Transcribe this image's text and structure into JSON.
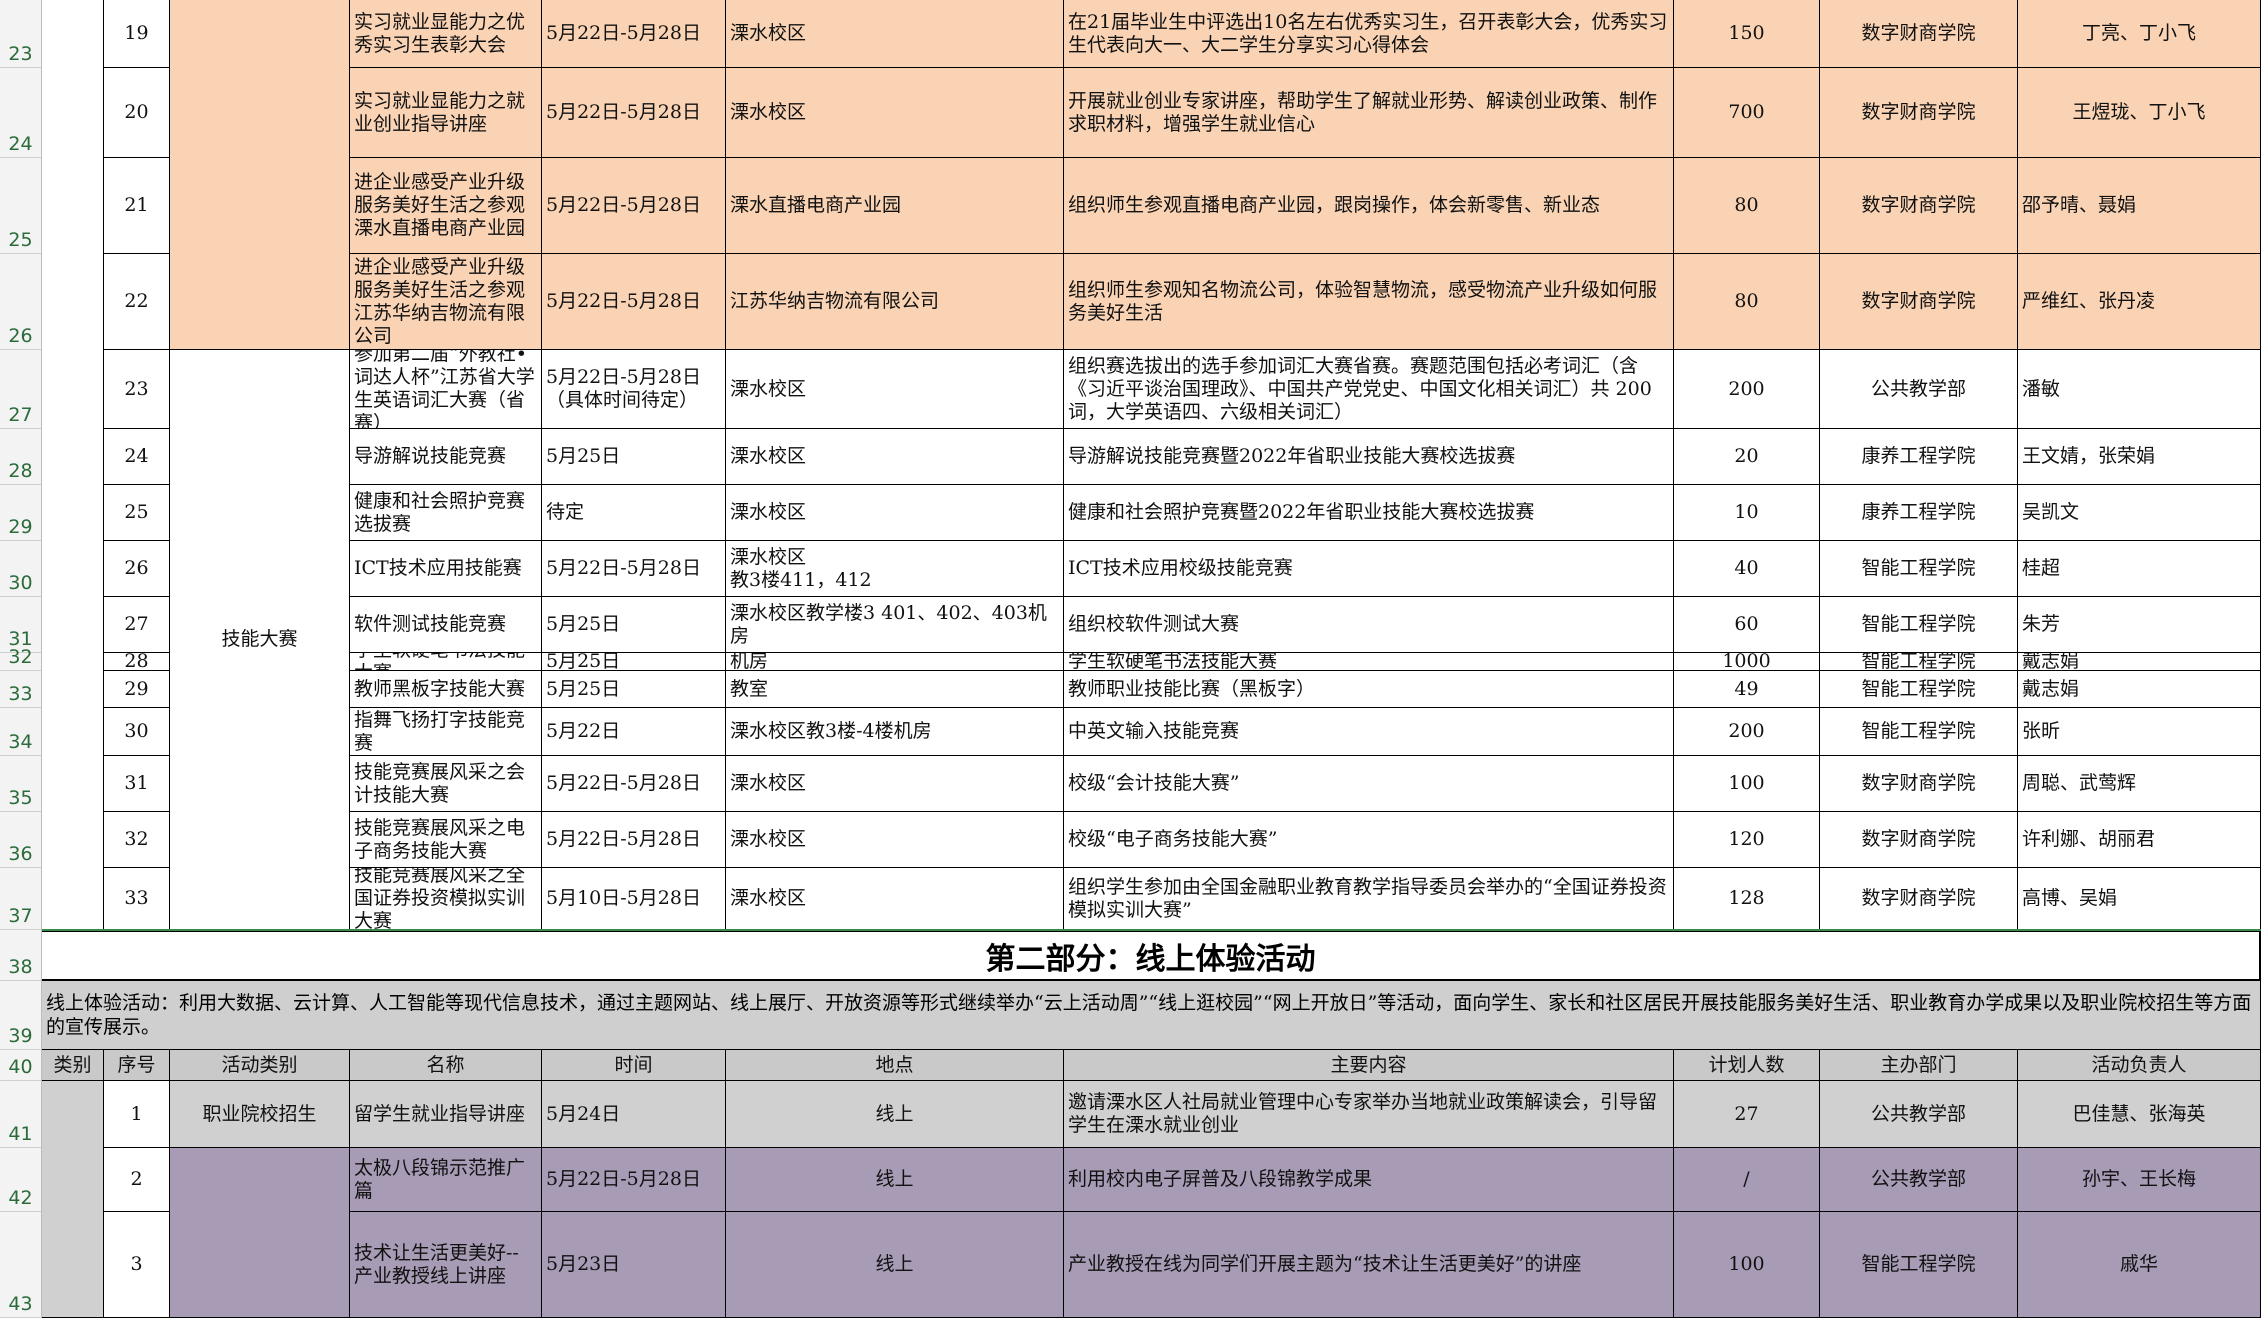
{
  "row_numbers": [
    "23",
    "24",
    "25",
    "26",
    "27",
    "28",
    "29",
    "30",
    "31",
    "32",
    "33",
    "34",
    "35",
    "36",
    "37",
    "38",
    "39",
    "40",
    "41",
    "42",
    "43"
  ],
  "part1": {
    "rows": [
      {
        "seq": "19",
        "name": "实习就业显能力之优秀实习生表彰大会",
        "time": "5月22日-5月28日",
        "place": "溧水校区",
        "content": "在21届毕业生中评选出10名左右优秀实习生，召开表彰大会，优秀实习生代表向大一、大二学生分享实习心得体会",
        "count": "150",
        "dept": "数字财商学院",
        "owner": "丁亮、丁小飞"
      },
      {
        "seq": "20",
        "name": "实习就业显能力之就业创业指导讲座",
        "time": "5月22日-5月28日",
        "place": "溧水校区",
        "content": "开展就业创业专家讲座，帮助学生了解就业形势、解读创业政策、制作求职材料，增强学生就业信心",
        "count": "700",
        "dept": "数字财商学院",
        "owner": "王煜珑、丁小飞"
      },
      {
        "seq": "21",
        "name": "进企业感受产业升级服务美好生活之参观溧水直播电商产业园",
        "time": "5月22日-5月28日",
        "place": "溧水直播电商产业园",
        "content": "组织师生参观直播电商产业园，跟岗操作，体会新零售、新业态",
        "count": "80",
        "dept": "数字财商学院",
        "owner": "邵予晴、聂娟"
      },
      {
        "seq": "22",
        "name": "进企业感受产业升级服务美好生活之参观江苏华纳吉物流有限公司",
        "time": "5月22日-5月28日",
        "place": "江苏华纳吉物流有限公司",
        "content": "组织师生参观知名物流公司，体验智慧物流，感受物流产业升级如何服务美好生活",
        "count": "80",
        "dept": "数字财商学院",
        "owner": "严维红、张丹凌"
      },
      {
        "seq": "23",
        "name": "参加第二届“外教社•词达人杯”江苏省大学生英语词汇大赛（省赛）",
        "time": "5月22日-5月28日（具体时间待定）",
        "place": "溧水校区",
        "content": "组织赛选拔出的选手参加词汇大赛省赛。赛题范围包括必考词汇（含《习近平谈治国理政》、中国共产党党史、中国文化相关词汇）共 200 词，大学英语四、六级相关词汇）",
        "count": "200",
        "dept": "公共教学部",
        "owner": "潘敏"
      },
      {
        "seq": "24",
        "name": "导游解说技能竞赛",
        "time": "5月25日",
        "place": "溧水校区",
        "content": "导游解说技能竞赛暨2022年省职业技能大赛校选拔赛",
        "count": "20",
        "dept": "康养工程学院",
        "owner": "王文婧，张荣娟"
      },
      {
        "seq": "25",
        "name": "健康和社会照护竞赛选拔赛",
        "time": "待定",
        "place": "溧水校区",
        "content": "健康和社会照护竞赛暨2022年省职业技能大赛校选拔赛",
        "count": "10",
        "dept": "康养工程学院",
        "owner": "吴凯文"
      },
      {
        "seq": "26",
        "name": "ICT技术应用技能赛",
        "time": "5月22日-5月28日",
        "place": "溧水校区\n教3楼411，412",
        "content": "ICT技术应用校级技能竞赛",
        "count": "40",
        "dept": "智能工程学院",
        "owner": "桂超"
      },
      {
        "seq": "27",
        "name": "软件测试技能竞赛",
        "time": "5月25日",
        "place": "溧水校区教学楼3 401、402、403机房",
        "content": "组织校软件测试大赛",
        "count": "60",
        "dept": "智能工程学院",
        "owner": "朱芳"
      },
      {
        "seq": "28",
        "name": "学生软硬笔书法技能大赛",
        "time": "5月25日",
        "place": "机房",
        "content": "学生软硬笔书法技能大赛",
        "count": "1000",
        "dept": "智能工程学院",
        "owner": "戴志娟"
      },
      {
        "seq": "29",
        "name": "教师黑板字技能大赛",
        "time": "5月25日",
        "place": "教室",
        "content": "教师职业技能比赛（黑板字）",
        "count": "49",
        "dept": "智能工程学院",
        "owner": "戴志娟"
      },
      {
        "seq": "30",
        "name": "指舞飞扬打字技能竞赛",
        "time": "5月22日",
        "place": "溧水校区教3楼-4楼机房",
        "content": "中英文输入技能竞赛",
        "count": "200",
        "dept": "智能工程学院",
        "owner": "张昕"
      },
      {
        "seq": "31",
        "name": "技能竞赛展风采之会计技能大赛",
        "time": "5月22日-5月28日",
        "place": "溧水校区",
        "content": "校级“会计技能大赛”",
        "count": "100",
        "dept": "数字财商学院",
        "owner": "周聪、武莺辉"
      },
      {
        "seq": "32",
        "name": "技能竞赛展风采之电子商务技能大赛",
        "time": "5月22日-5月28日",
        "place": "溧水校区",
        "content": "校级“电子商务技能大赛”",
        "count": "120",
        "dept": "数字财商学院",
        "owner": "许利娜、胡丽君"
      },
      {
        "seq": "33",
        "name": "技能竞赛展风采之全国证券投资模拟实训大赛",
        "time": "5月10日-5月28日",
        "place": "溧水校区",
        "content": "组织学生参加由全国金融职业教育教学指导委员会举办的“全国证券投资模拟实训大赛”",
        "count": "128",
        "dept": "数字财商学院",
        "owner": "高博、吴娟"
      }
    ],
    "skill_category": "技能大赛"
  },
  "part2": {
    "title": "第二部分：线上体验活动",
    "description": "线上体验活动：利用大数据、云计算、人工智能等现代信息技术，通过主题网站、线上展厅、开放资源等形式继续举办“云上活动周”“线上逛校园”“网上开放日”等活动，面向学生、家长和社区居民开展技能服务美好生活、职业教育办学成果以及职业院校招生等方面的宣传展示。",
    "headers": [
      "类别",
      "序号",
      "活动类别",
      "名称",
      "时间",
      "地点",
      "主要内容",
      "计划人数",
      "主办部门",
      "活动负责人"
    ],
    "rows": [
      {
        "seq": "1",
        "type": "职业院校招生",
        "name": "留学生就业指导讲座",
        "time": "5月24日",
        "place": "线上",
        "content": "邀请溧水区人社局就业管理中心专家举办当地就业政策解读会，引导留学生在溧水就业创业",
        "count": "27",
        "dept": "公共教学部",
        "owner": "巴佳慧、张海英"
      },
      {
        "seq": "2",
        "type": "",
        "name": "太极八段锦示范推广篇",
        "time": "5月22日-5月28日",
        "place": "线上",
        "content": "利用校内电子屏普及八段锦教学成果",
        "count": "/",
        "dept": "公共教学部",
        "owner": "孙宇、王长梅"
      },
      {
        "seq": "3",
        "type": "",
        "name": "技术让生活更美好--产业教授线上讲座",
        "time": "5月23日",
        "place": "线上",
        "content": "产业教授在线为同学们开展主题为“技术让生活更美好”的讲座",
        "count": "100",
        "dept": "智能工程学院",
        "owner": "戚华"
      }
    ]
  },
  "colors": {
    "peach": "#f9d3b4",
    "purple": "#a79bb5",
    "header_gray": "#c9c9c9",
    "row_number_green": "#2b6b3a"
  }
}
